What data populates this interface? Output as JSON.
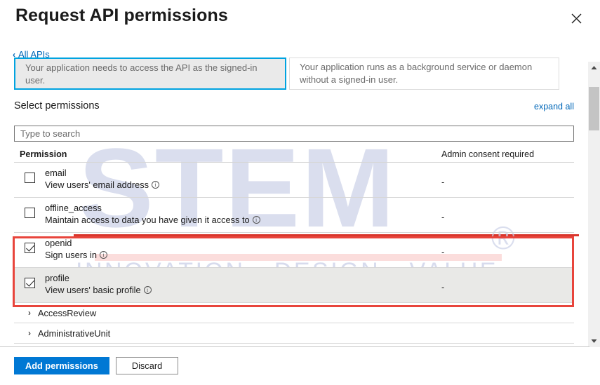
{
  "dialog": {
    "title": "Request API permissions",
    "close_icon": "close-icon"
  },
  "back_link": {
    "label": "All APIs",
    "chevron": "‹"
  },
  "permission_type_cards": [
    {
      "selected": true,
      "description": "Your application needs to access the API as the signed-in user."
    },
    {
      "selected": false,
      "description": "Your application runs as a background service or daemon without a signed-in user."
    }
  ],
  "section": {
    "heading": "Select permissions",
    "expand_all": "expand all"
  },
  "search": {
    "value": "",
    "placeholder": "Type to search"
  },
  "table": {
    "headers": {
      "permission": "Permission",
      "admin_consent": "Admin consent required"
    },
    "rows": [
      {
        "name": "email",
        "description": "View users' email address",
        "checked": false,
        "admin_consent": "-",
        "shaded": false,
        "info_icon": "info-icon"
      },
      {
        "name": "offline_access",
        "description": "Maintain access to data you have given it access to",
        "checked": false,
        "admin_consent": "-",
        "shaded": false,
        "info_icon": "info-icon"
      },
      {
        "name": "openid",
        "description": "Sign users in",
        "checked": true,
        "admin_consent": "-",
        "shaded": false,
        "info_icon": "info-icon"
      },
      {
        "name": "profile",
        "description": "View users' basic profile",
        "checked": true,
        "admin_consent": "-",
        "shaded": true,
        "info_icon": "info-icon"
      }
    ],
    "groups": [
      {
        "label": "AccessReview",
        "chevron": "›"
      },
      {
        "label": "AdministrativeUnit",
        "chevron": "›"
      }
    ]
  },
  "footer": {
    "add_label": "Add permissions",
    "discard_label": "Discard"
  },
  "scrollbar": {
    "up_icon": "scroll-up-arrow-icon",
    "down_icon": "scroll-down-arrow-icon"
  },
  "watermark": {
    "text": "STEM",
    "registered": "®",
    "tagline": "INNOVATION • DESIGN • VALUE"
  },
  "colors": {
    "accent_blue": "#0078d4",
    "link_blue": "#0067b8",
    "selected_card_border": "#00a3e0",
    "annotation_red": "#e8453c",
    "row_shade": "#e9e9e7",
    "watermark": "#ccd2e8"
  }
}
